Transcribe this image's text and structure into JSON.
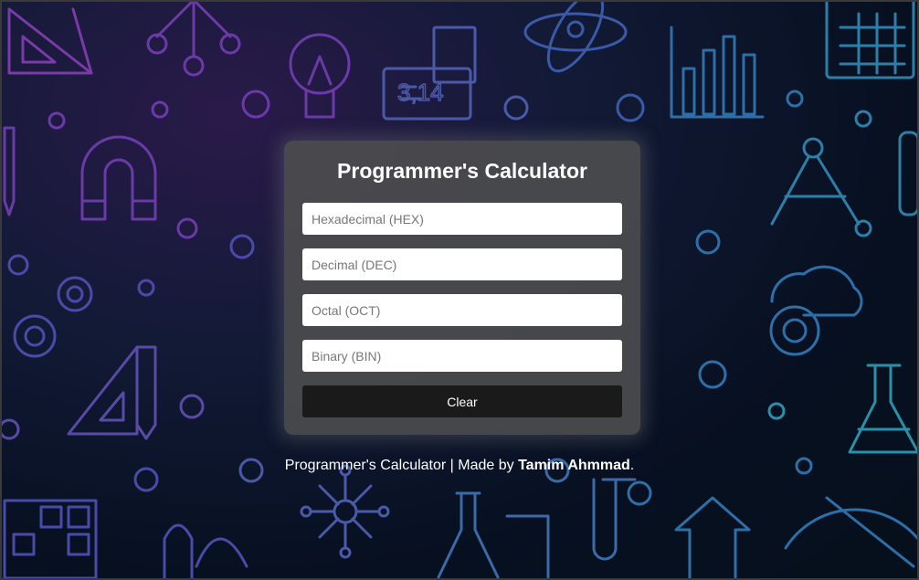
{
  "app": {
    "title": "Programmer's Calculator"
  },
  "fields": {
    "hex": {
      "value": "",
      "placeholder": "Hexadecimal (HEX)"
    },
    "dec": {
      "value": "",
      "placeholder": "Decimal (DEC)"
    },
    "oct": {
      "value": "",
      "placeholder": "Octal (OCT)"
    },
    "bin": {
      "value": "",
      "placeholder": "Binary (BIN)"
    }
  },
  "actions": {
    "clear_label": "Clear"
  },
  "footer": {
    "prefix": "Programmer's Calculator | Made by ",
    "author": "Tamim Ahmmad",
    "suffix": "."
  },
  "background": {
    "icons": [
      "set-square-icon",
      "molecule-icon",
      "light-bulb-icon",
      "calculator-display-icon",
      "atom-icon",
      "bar-chart-icon",
      "calculator-icon",
      "pencil-icon",
      "magnet-icon",
      "compass-icon",
      "test-tube-icon",
      "gears-icon",
      "cloud-gear-icon",
      "flask-icon",
      "binary-grid-icon",
      "network-icon",
      "beaker-icon",
      "arrows-up-icon"
    ],
    "colors": {
      "purple": "#6b3aa8",
      "blue": "#2d5fa8",
      "teal": "#2a8fa8"
    }
  },
  "theme": {
    "card_bg": "#4e4e4e",
    "button_bg": "#1a1a1a",
    "text": "#ffffff"
  }
}
